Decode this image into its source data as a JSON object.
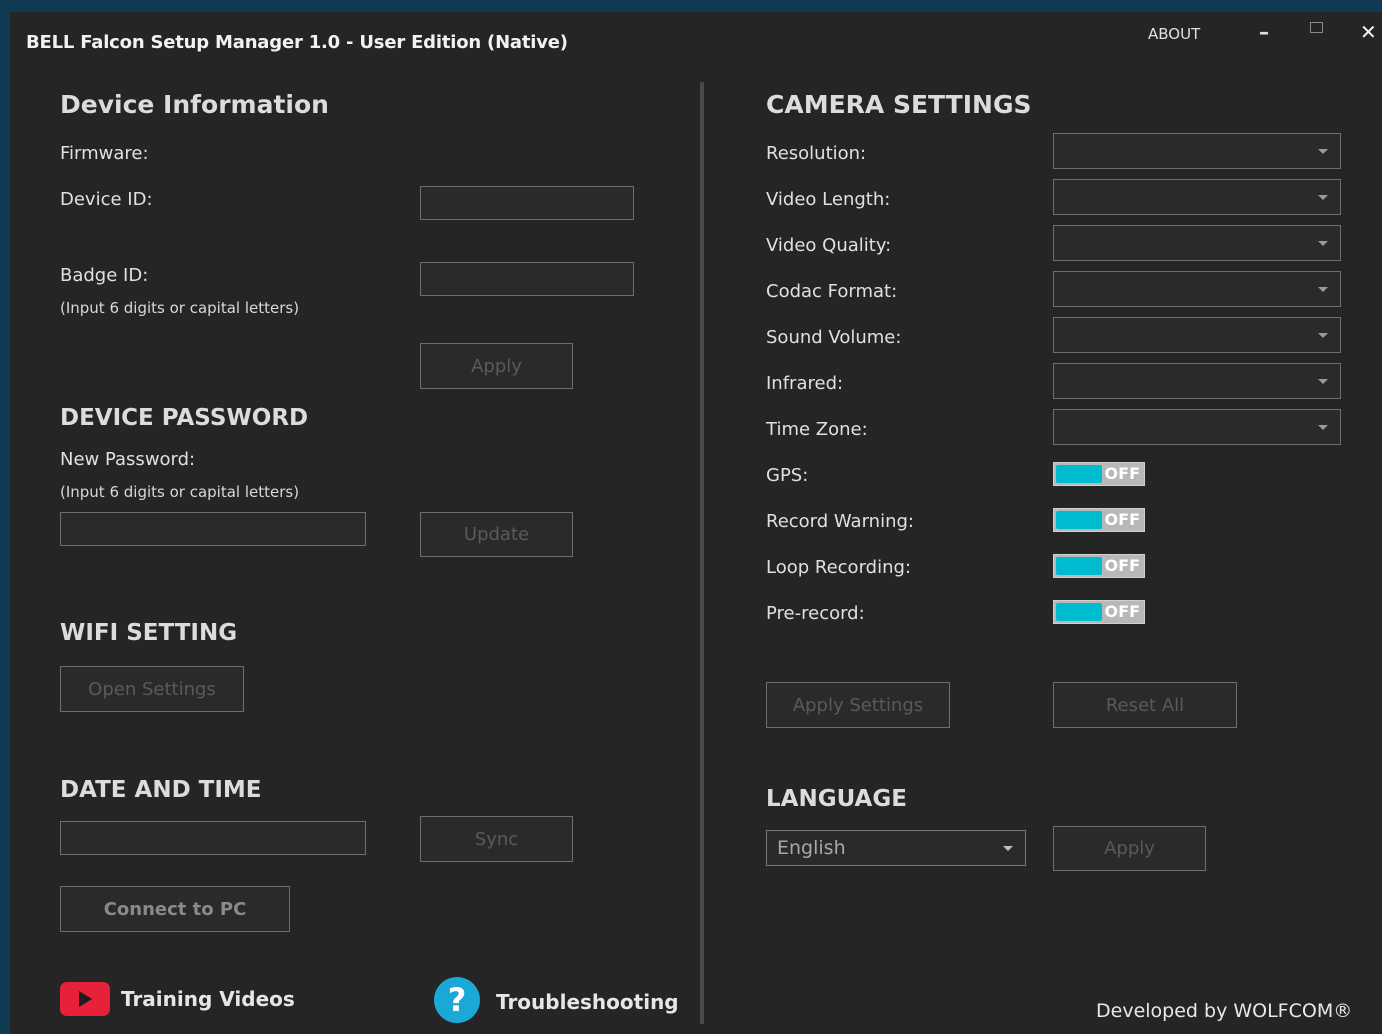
{
  "window": {
    "title": "BELL Falcon Setup Manager 1.0 - User Edition (Native)",
    "about": "ABOUT",
    "minimize": "–",
    "close": "✕"
  },
  "device_info": {
    "heading": "Device Information",
    "firmware_label": "Firmware:",
    "device_id_label": "Device ID:",
    "device_id_value": "",
    "badge_id_label": "Badge ID:",
    "badge_id_hint": "(Input 6 digits or capital letters)",
    "badge_id_value": "",
    "apply_label": "Apply"
  },
  "password": {
    "heading": "DEVICE PASSWORD",
    "new_label": "New Password:",
    "hint": "(Input 6 digits or capital letters)",
    "value": "",
    "update_label": "Update"
  },
  "wifi": {
    "heading": "WIFI SETTING",
    "open_label": "Open Settings"
  },
  "datetime": {
    "heading": "DATE AND TIME",
    "value": "",
    "sync_label": "Sync",
    "connect_label": "Connect to PC"
  },
  "links": {
    "training": "Training Videos",
    "troubleshooting": "Troubleshooting"
  },
  "camera": {
    "heading": "CAMERA SETTINGS",
    "dropdowns": [
      {
        "label": "Resolution:",
        "value": ""
      },
      {
        "label": "Video Length:",
        "value": ""
      },
      {
        "label": "Video Quality:",
        "value": ""
      },
      {
        "label": "Codac Format:",
        "value": ""
      },
      {
        "label": "Sound Volume:",
        "value": ""
      },
      {
        "label": "Infrared:",
        "value": ""
      },
      {
        "label": "Time Zone:",
        "value": ""
      }
    ],
    "toggles": [
      {
        "label": "GPS:",
        "state": "OFF"
      },
      {
        "label": "Record Warning:",
        "state": "OFF"
      },
      {
        "label": "Loop Recording:",
        "state": "OFF"
      },
      {
        "label": "Pre-record:",
        "state": "OFF"
      }
    ],
    "apply_label": "Apply Settings",
    "reset_label": "Reset All"
  },
  "language": {
    "heading": "LANGUAGE",
    "selected": "English",
    "apply_label": "Apply"
  },
  "footer": "Developed by WOLFCOM®",
  "colors": {
    "background": "#252525",
    "toggle_accent": "#00bcd0",
    "youtube_red": "#e8213a",
    "help_blue": "#1aa9d6"
  }
}
